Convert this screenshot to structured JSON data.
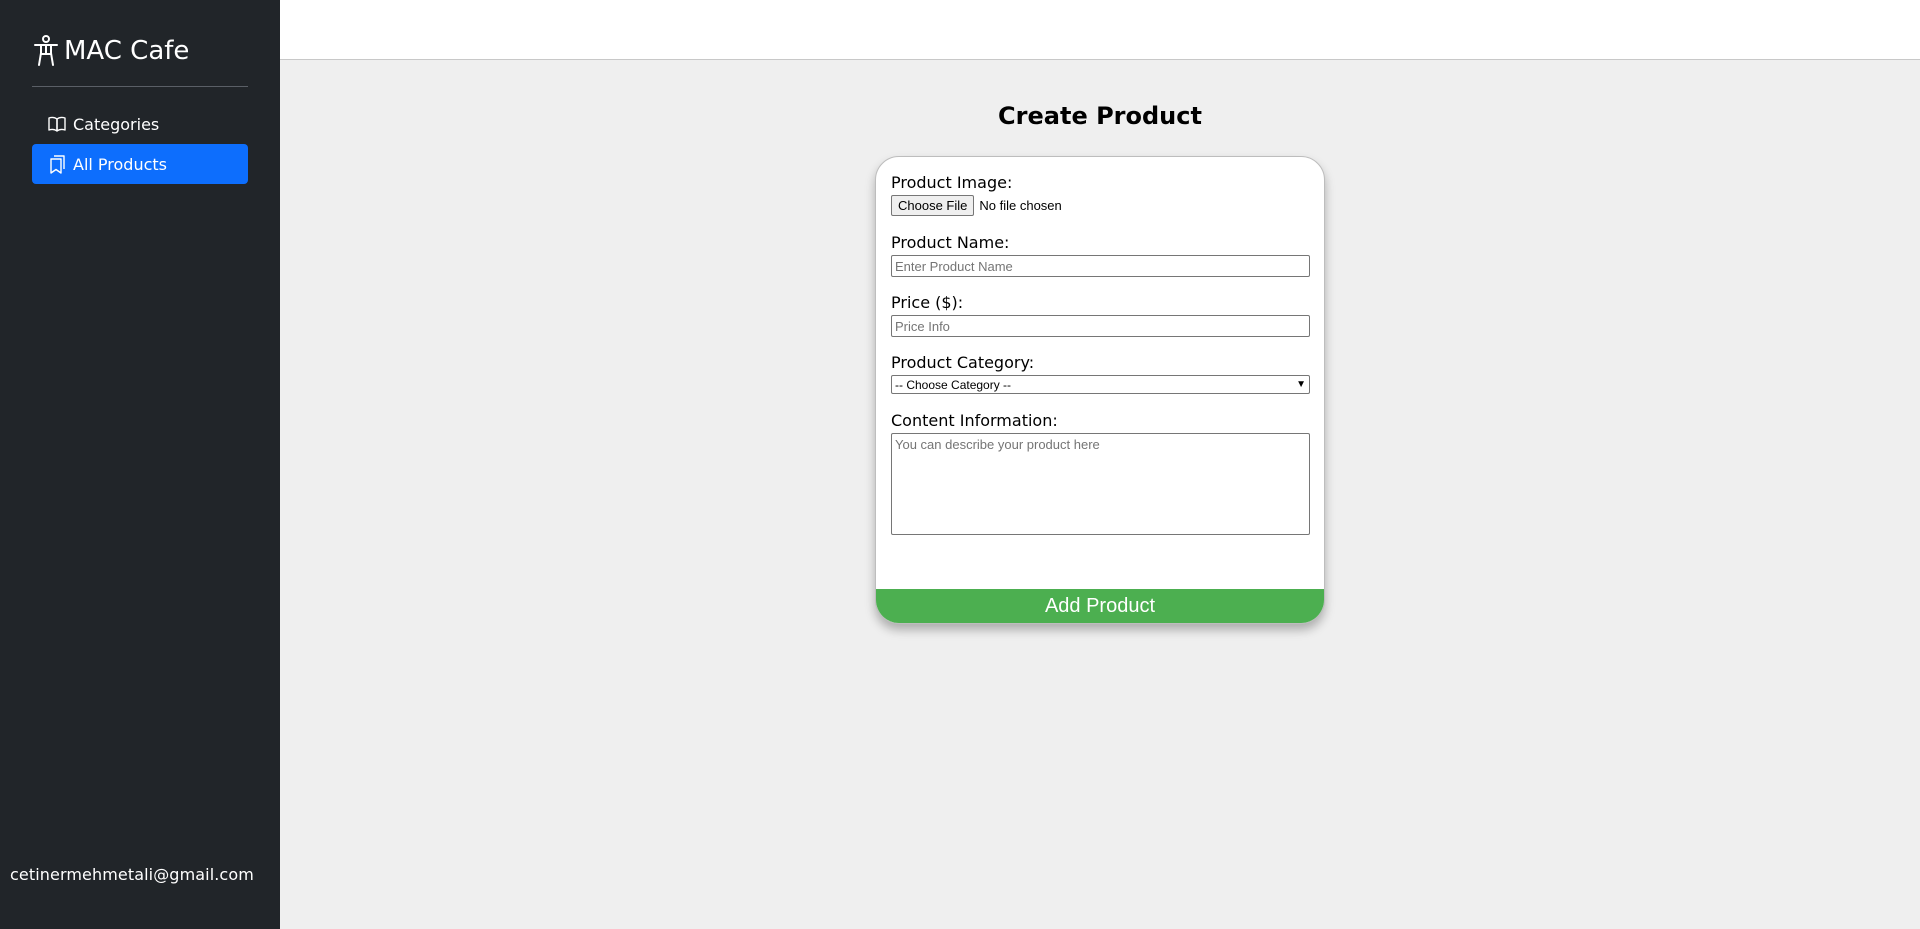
{
  "sidebar": {
    "brand": "MAC Cafe",
    "brand_icon": "accessibility-person-icon",
    "items": [
      {
        "label": "Categories",
        "icon": "book-icon",
        "active": false
      },
      {
        "label": "All Products",
        "icon": "bookmarks-icon",
        "active": true
      }
    ],
    "user_email": "cetinermehmetali@gmail.com"
  },
  "main": {
    "title": "Create Product",
    "form": {
      "image_label": "Product Image:",
      "file_button": "Choose File",
      "file_status": "No file chosen",
      "name_label": "Product Name:",
      "name_placeholder": "Enter Product Name",
      "price_label": "Price ($):",
      "price_placeholder": "Price Info",
      "category_label": "Product Category:",
      "category_selected": "-- Choose Category --",
      "content_label": "Content Information:",
      "content_placeholder": "You can describe your product here",
      "submit_label": "Add Product"
    }
  },
  "colors": {
    "sidebar_bg": "#212529",
    "active_item": "#0d6efd",
    "submit_bg": "#4caf50",
    "page_bg": "#efefef"
  }
}
